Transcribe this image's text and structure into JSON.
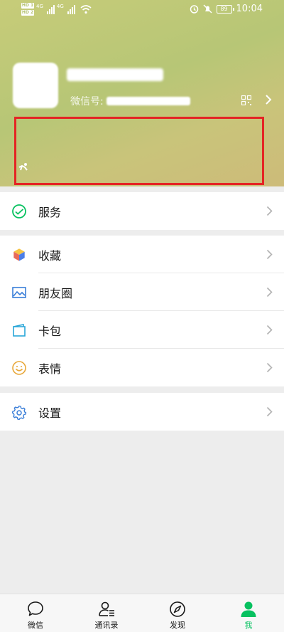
{
  "status_bar": {
    "sim1": "HD 1",
    "sim2": "HD 2",
    "net1": "4G",
    "net2": "4G",
    "battery": "89",
    "time": "10:04"
  },
  "profile": {
    "wechat_id_label": "微信号:",
    "icons": [
      "qr-code-icon",
      "chevron-right-icon",
      "running-status-icon"
    ]
  },
  "menu": {
    "services": {
      "label": "服务",
      "icon": "wallet-icon"
    },
    "favorites": {
      "label": "收藏",
      "icon": "cube-icon"
    },
    "moments": {
      "label": "朋友圈",
      "icon": "picture-icon"
    },
    "cards": {
      "label": "卡包",
      "icon": "card-icon"
    },
    "stickers": {
      "label": "表情",
      "icon": "smiley-icon"
    },
    "settings": {
      "label": "设置",
      "icon": "gear-icon"
    }
  },
  "tabbar": {
    "tabs": [
      {
        "label": "微信",
        "icon": "chat-bubble-icon",
        "active": false
      },
      {
        "label": "通讯录",
        "icon": "contacts-icon",
        "active": false
      },
      {
        "label": "发现",
        "icon": "compass-icon",
        "active": false
      },
      {
        "label": "我",
        "icon": "person-icon",
        "active": true
      }
    ]
  },
  "colors": {
    "accent_green": "#07c160",
    "highlight_box": "#e42424",
    "background": "#ededed"
  }
}
